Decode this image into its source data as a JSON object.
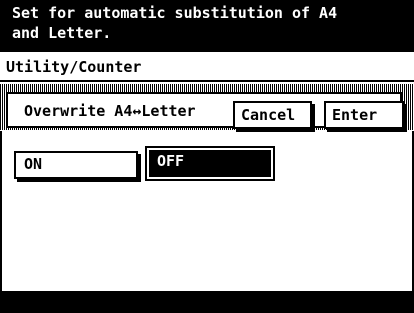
{
  "message": {
    "line1": "Set for automatic substitution of A4",
    "line2": "and Letter."
  },
  "breadcrumb": "Utility/Counter",
  "function_title": "Overwrite A4↔Letter",
  "buttons": {
    "cancel": "Cancel",
    "enter": "Enter"
  },
  "options": {
    "on": "ON",
    "off": "OFF",
    "selected": "OFF"
  }
}
